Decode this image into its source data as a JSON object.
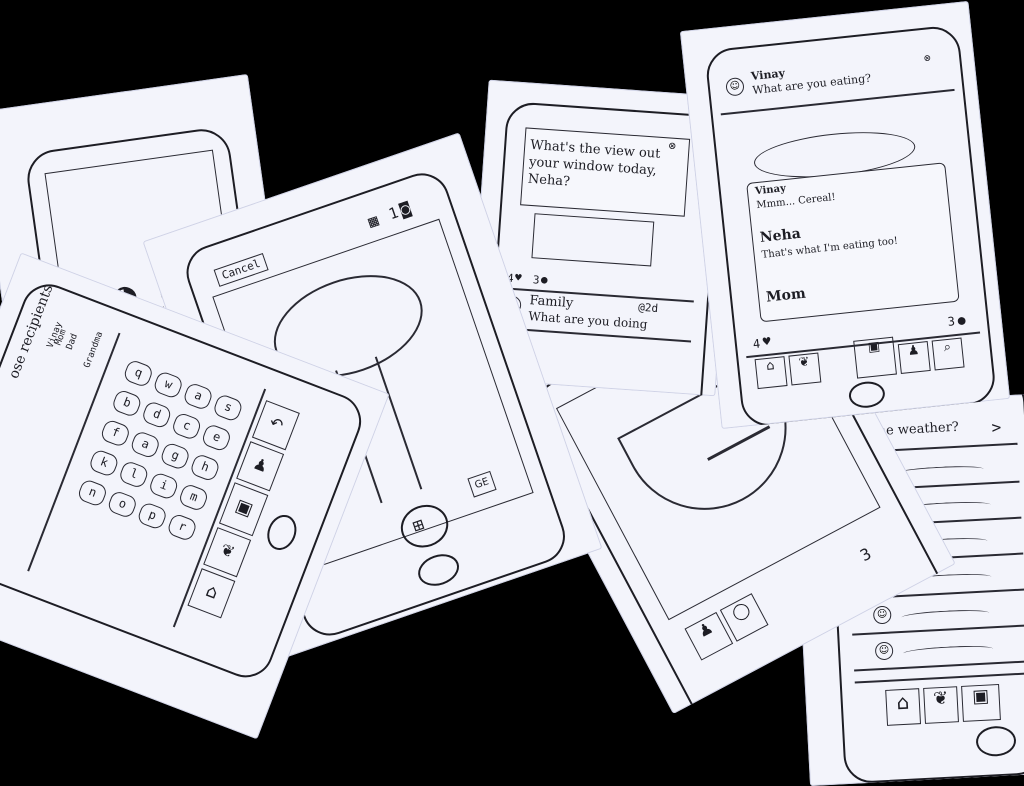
{
  "sketch_keyboard": {
    "title": "ose recipients",
    "contacts": [
      "Vinay",
      "Mom",
      "Dad",
      "Grandma"
    ],
    "keys": [
      "q",
      "w",
      "a",
      "s",
      "b",
      "d",
      "c",
      "e",
      "f",
      "a",
      "g",
      "h",
      "k",
      "l",
      "i",
      "m",
      "n",
      "o",
      "p",
      "r"
    ]
  },
  "sketch_camera": {
    "cancel_label": "Cancel",
    "count": "1",
    "gallery_label": "GE"
  },
  "sketch_prompt": {
    "prompt_text": "What's the view out your window today, Neha?",
    "likes": "4",
    "comments": "3",
    "group_name": "Family",
    "time": "@2d",
    "question": "What are you doing"
  },
  "sketch_chat": {
    "sender_top": "Vinay",
    "question_top": "What are you eating?",
    "bubble": [
      {
        "name": "Vinay",
        "text": "Mmm... Cereal!"
      },
      {
        "name": "Neha",
        "text": "That's what I'm eating too!"
      },
      {
        "name": "Mom",
        "text": ""
      }
    ],
    "likes": "4",
    "comments": "3"
  },
  "sketch_weather": {
    "question": "s the weather?",
    "chevron": ">"
  },
  "sketch_bowl": {
    "likes": "3"
  }
}
